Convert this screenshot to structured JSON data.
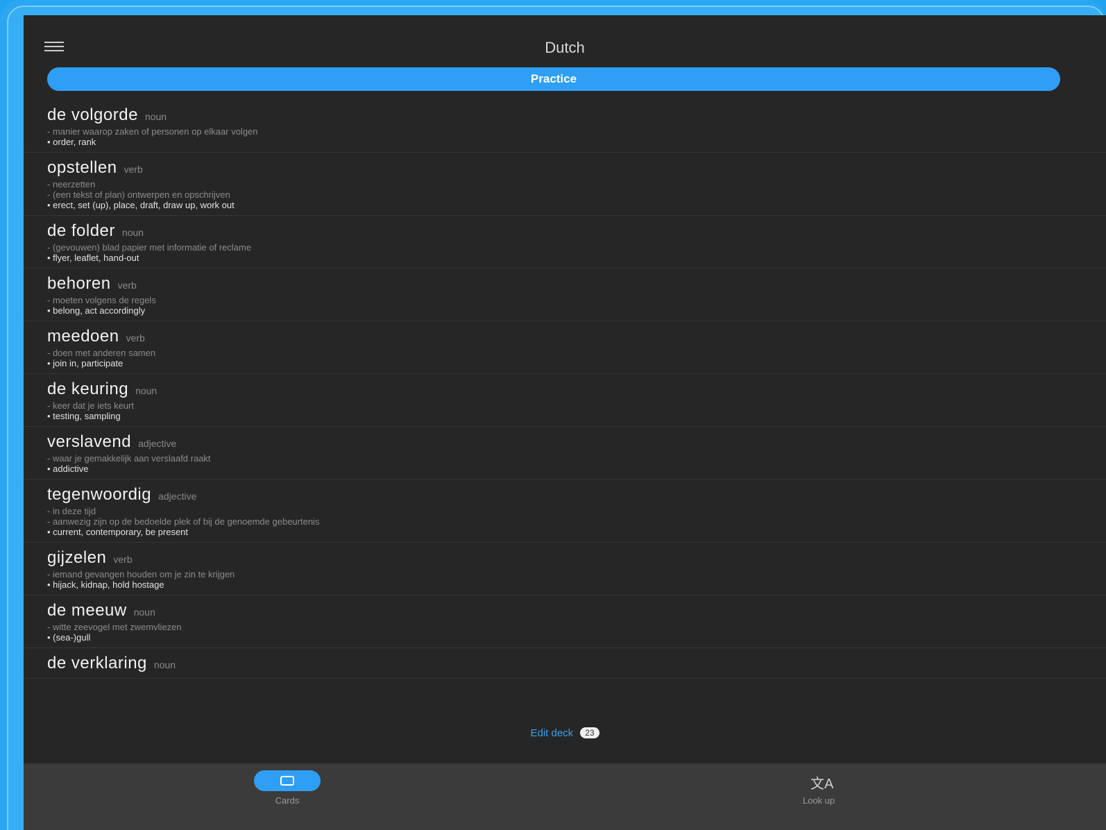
{
  "app": {
    "title": "Dutch"
  },
  "practice": {
    "label": "Practice"
  },
  "cards": [
    {
      "word": "de volgorde",
      "pos": "noun",
      "defs": [
        "- manier waarop zaken of personen op elkaar volgen"
      ],
      "translation": "• order, rank"
    },
    {
      "word": "opstellen",
      "pos": "verb",
      "defs": [
        "- neerzetten",
        "- (een tekst of plan) ontwerpen en opschrijven"
      ],
      "translation": "• erect, set (up), place, draft, draw up, work out"
    },
    {
      "word": "de folder",
      "pos": "noun",
      "defs": [
        "- (gevouwen) blad papier met informatie of reclame"
      ],
      "translation": "• flyer, leaflet, hand-out"
    },
    {
      "word": "behoren",
      "pos": "verb",
      "defs": [
        "- moeten volgens de regels"
      ],
      "translation": "• belong, act accordingly"
    },
    {
      "word": "meedoen",
      "pos": "verb",
      "defs": [
        "- doen met anderen samen"
      ],
      "translation": "• join in, participate"
    },
    {
      "word": "de keuring",
      "pos": "noun",
      "defs": [
        "- keer dat je iets keurt"
      ],
      "translation": "• testing, sampling"
    },
    {
      "word": "verslavend",
      "pos": "adjective",
      "defs": [
        "- waar je gemakkelijk aan verslaafd raakt"
      ],
      "translation": "• addictive"
    },
    {
      "word": "tegenwoordig",
      "pos": "adjective",
      "defs": [
        "- in deze tijd",
        "- aanwezig zijn op de bedoelde plek of bij de genoemde gebeurtenis"
      ],
      "translation": "• current, contemporary, be present"
    },
    {
      "word": "gijzelen",
      "pos": "verb",
      "defs": [
        "- iemand gevangen houden om je zin te krijgen"
      ],
      "translation": "• hijack, kidnap, hold hostage"
    },
    {
      "word": "de meeuw",
      "pos": "noun",
      "defs": [
        "- witte zeevogel met zwemvliezen"
      ],
      "translation": "• (sea-)gull"
    },
    {
      "word": "de verklaring",
      "pos": "noun",
      "defs": [],
      "translation": ""
    }
  ],
  "edit": {
    "label": "Edit deck",
    "count": "23"
  },
  "nav": {
    "cards": {
      "label": "Cards",
      "icon": "cards-icon"
    },
    "lookup": {
      "label": "Look up",
      "icon": "translate-icon"
    }
  },
  "colors": {
    "accent": "#2f9ff5",
    "background": "#262626",
    "navbar": "#3b3b3b"
  }
}
